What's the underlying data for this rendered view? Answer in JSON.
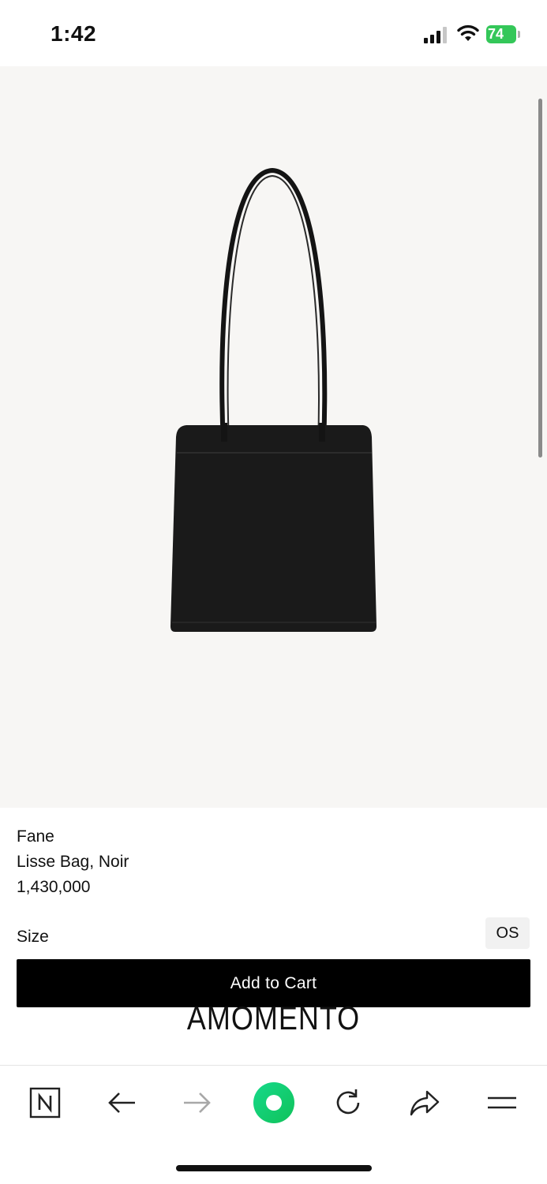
{
  "status": {
    "time": "1:42",
    "battery": "74"
  },
  "product": {
    "brand": "Fane",
    "name": "Lisse Bag, Noir",
    "price": "1,430,000",
    "size_label": "Size",
    "size_option": "OS",
    "add_to_cart": "Add to Cart",
    "store_logo": "AMOMENTO"
  },
  "toolbar": {
    "icons": [
      "naver-n-icon",
      "back-arrow-icon",
      "forward-arrow-icon",
      "green-dot-icon",
      "reload-icon",
      "share-icon",
      "menu-icon"
    ]
  },
  "colors": {
    "accent": "#19d37a",
    "battery": "#34c759",
    "image_bg": "#f7f6f4"
  }
}
